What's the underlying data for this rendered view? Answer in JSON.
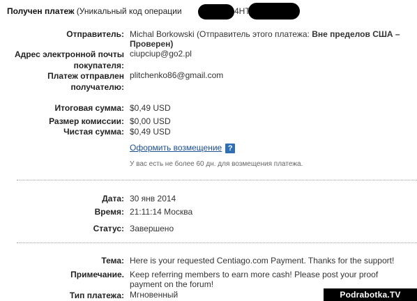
{
  "header": {
    "title_bold": "Получен платеж",
    "title_rest": " (Уникальный код операции",
    "code_fragment": "4НТ"
  },
  "sender": {
    "sender_label": "Отправитель:",
    "sender_name": "Michal Borkowski",
    "sender_status_prefix": " (Отправитель этого платежа: ",
    "sender_status_bold": "Вне пределов США –",
    "sender_status_line2": "Проверен)",
    "email_label_line1": "Адрес электронной почты",
    "email_label_line2": "покупателя:",
    "email_value": "ciupciup@go2.pl",
    "sent_to_label_line1": "Платеж отправлен",
    "sent_to_label_line2": "получателю:",
    "sent_to_value": "plitchenko86@gmail.com"
  },
  "amounts": {
    "total_label": "Итоговая сумма:",
    "total_value": "$0,49 USD",
    "fee_label": "Размер комиссии:",
    "fee_value": "$0,00 USD",
    "net_label": "Чистая сумма:",
    "net_value": "$0,49 USD",
    "refund_link": "Оформить возмещение",
    "help_icon_text": "?",
    "refund_note": "У вас есть не более 60 дн. для возмещения платежа."
  },
  "details": {
    "date_label": "Дата:",
    "date_value": "30 янв 2014",
    "time_label": "Время:",
    "time_value": "21:11:14 Москва",
    "status_label": "Статус:",
    "status_value": "Завершено"
  },
  "message": {
    "subject_label": "Тема:",
    "subject_value": "Here is your requested Centiago.com Payment. Thanks for the support!",
    "note_label": "Примечание.",
    "note_line1": "Keep referring members to earn more cash! Please post your proof",
    "note_line2": "payment on the forum!",
    "type_label": "Тип платежа:",
    "type_value": "Мгновенный"
  },
  "watermark": "Podrabotka.TV",
  "colors": {
    "link": "#1a4d92",
    "help_icon_bg": "#2e6fb5"
  }
}
